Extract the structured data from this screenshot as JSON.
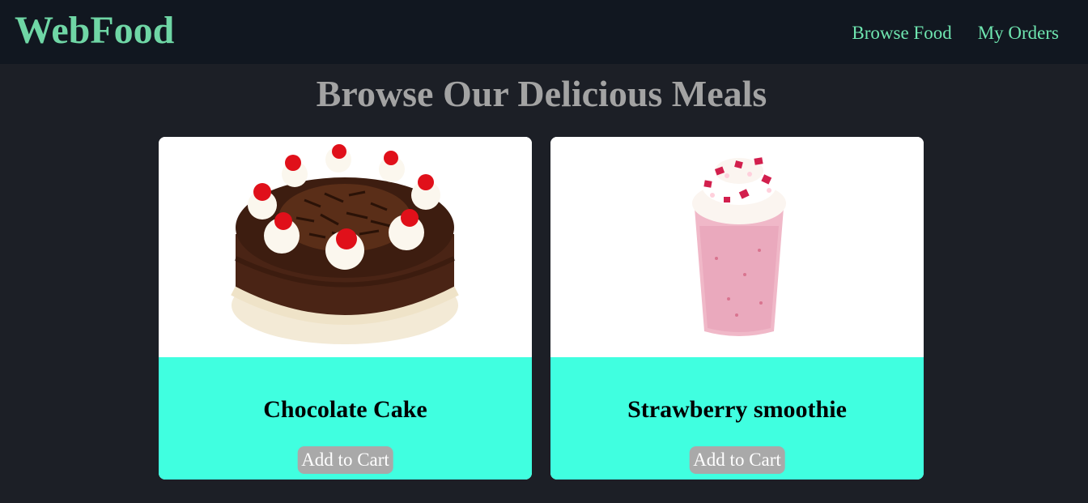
{
  "header": {
    "brand": "WebFood",
    "nav": [
      {
        "label": "Browse Food"
      },
      {
        "label": "My Orders"
      }
    ]
  },
  "main": {
    "title": "Browse Our Delicious Meals",
    "items": [
      {
        "name": "Chocolate Cake",
        "button_label": "Add to Cart",
        "image": "chocolate-cake-image"
      },
      {
        "name": "Strawberry smoothie",
        "button_label": "Add to Cart",
        "image": "strawberry-smoothie-image"
      }
    ]
  },
  "colors": {
    "page_bg": "#1c1f26",
    "navbar_bg": "#111720",
    "brand": "#6fd6a5",
    "nav_link": "#6fe6b0",
    "title": "#a3a3a3",
    "card_body": "#40ffe0",
    "button_bg": "#a9a9a9"
  }
}
